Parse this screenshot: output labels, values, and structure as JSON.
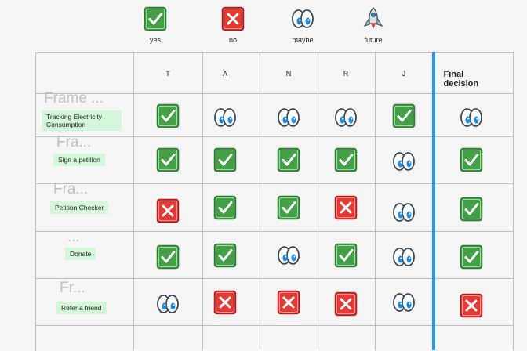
{
  "legend": [
    {
      "icon": "check-icon",
      "label": "yes"
    },
    {
      "icon": "cross-icon",
      "label": "no"
    },
    {
      "icon": "eyes-icon",
      "label": "maybe"
    },
    {
      "icon": "rocket-icon",
      "label": "future"
    }
  ],
  "columns": [
    "T",
    "A",
    "N",
    "R",
    "J",
    "Final decision"
  ],
  "rows": [
    {
      "frame": "Frame ...",
      "label": "Tracking Electricity Consumption",
      "votes": [
        "check-icon",
        "eyes-icon",
        "eyes-icon",
        "eyes-icon",
        "check-icon",
        "eyes-icon"
      ]
    },
    {
      "frame": "Fra...",
      "label": "Sign a petition",
      "votes": [
        "check-icon",
        "check-icon",
        "check-icon",
        "check-icon",
        "eyes-icon",
        "check-icon"
      ]
    },
    {
      "frame": "Fra...",
      "label": "Petition Checker",
      "votes": [
        "cross-icon",
        "check-icon",
        "check-icon",
        "cross-icon",
        "eyes-icon",
        "check-icon"
      ]
    },
    {
      "frame": "...",
      "label": "Donate",
      "votes": [
        "check-icon",
        "check-icon",
        "eyes-icon",
        "check-icon",
        "eyes-icon",
        "check-icon"
      ]
    },
    {
      "frame": "Fr...",
      "label": "Refer a friend",
      "votes": [
        "eyes-icon",
        "cross-icon",
        "cross-icon",
        "cross-icon",
        "eyes-icon",
        "cross-icon"
      ]
    }
  ],
  "colors": {
    "check_fill": "#43a047",
    "cross_fill": "#e53935",
    "accent_bar": "#2196f3",
    "sticky_bg": "#d4f7d9"
  }
}
